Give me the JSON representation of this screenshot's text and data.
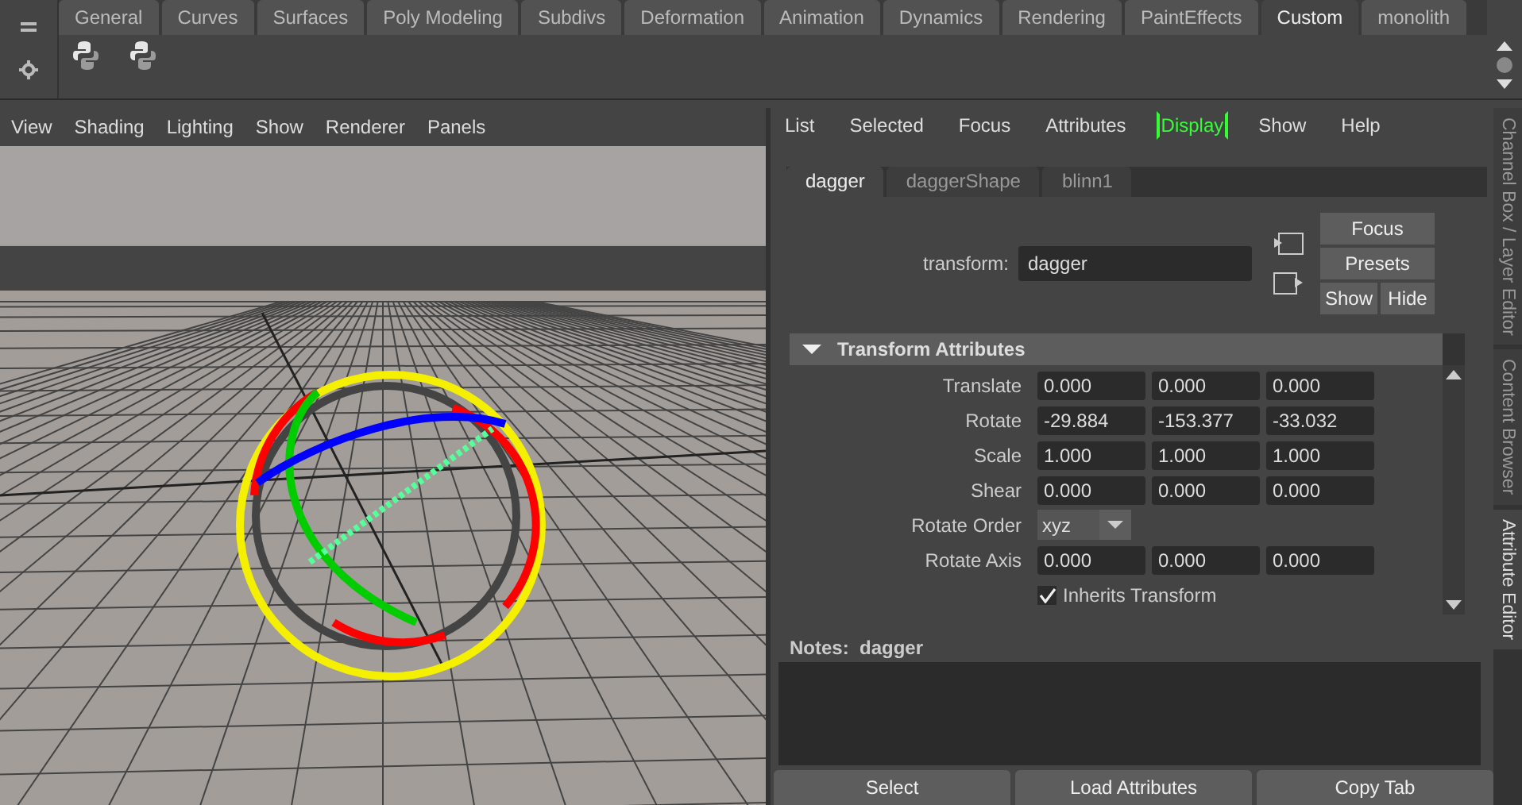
{
  "shelf": {
    "tabs": [
      {
        "label": "General",
        "selected": false
      },
      {
        "label": "Curves",
        "selected": false
      },
      {
        "label": "Surfaces",
        "selected": false
      },
      {
        "label": "Poly Modeling",
        "selected": false
      },
      {
        "label": "Subdivs",
        "selected": false
      },
      {
        "label": "Deformation",
        "selected": false
      },
      {
        "label": "Animation",
        "selected": false
      },
      {
        "label": "Dynamics",
        "selected": false
      },
      {
        "label": "Rendering",
        "selected": false
      },
      {
        "label": "PaintEffects",
        "selected": false
      },
      {
        "label": "Custom",
        "selected": true
      },
      {
        "label": "monolith",
        "selected": false
      }
    ]
  },
  "viewport": {
    "menu": [
      "View",
      "Shading",
      "Lighting",
      "Show",
      "Renderer",
      "Panels"
    ]
  },
  "attribute_editor": {
    "menu": [
      {
        "label": "List",
        "highlighted": false
      },
      {
        "label": "Selected",
        "highlighted": false
      },
      {
        "label": "Focus",
        "highlighted": false
      },
      {
        "label": "Attributes",
        "highlighted": false
      },
      {
        "label": "Display",
        "highlighted": true
      },
      {
        "label": "Show",
        "highlighted": false
      },
      {
        "label": "Help",
        "highlighted": false
      }
    ],
    "node_tabs": [
      {
        "label": "dagger",
        "selected": true
      },
      {
        "label": "daggerShape",
        "selected": false
      },
      {
        "label": "blinn1",
        "selected": false
      }
    ],
    "node_label": "transform:",
    "node_name": "dagger",
    "buttons": [
      "Focus",
      "Presets",
      "Show",
      "Hide"
    ],
    "section": {
      "title": "Transform Attributes",
      "expanded": true
    },
    "attributes": [
      {
        "kind": "vector",
        "label": "Translate",
        "values": [
          "0.000",
          "0.000",
          "0.000"
        ]
      },
      {
        "kind": "vector",
        "label": "Rotate",
        "values": [
          "-29.884",
          "-153.377",
          "-33.032"
        ]
      },
      {
        "kind": "vector",
        "label": "Scale",
        "values": [
          "1.000",
          "1.000",
          "1.000"
        ]
      },
      {
        "kind": "vector",
        "label": "Shear",
        "values": [
          "0.000",
          "0.000",
          "0.000"
        ]
      },
      {
        "kind": "dropdown",
        "label": "Rotate Order",
        "value": "xyz"
      },
      {
        "kind": "vector",
        "label": "Rotate Axis",
        "values": [
          "0.000",
          "0.000",
          "0.000"
        ]
      },
      {
        "kind": "checkbox",
        "label": "Inherits Transform",
        "checked": true
      }
    ],
    "notes_label": "Notes:  dagger",
    "bottom_buttons": [
      "Select",
      "Load Attributes",
      "Copy Tab"
    ]
  },
  "side_tabs": [
    {
      "label": "Channel Box / Layer Editor",
      "selected": false
    },
    {
      "label": "Content Browser",
      "selected": false
    },
    {
      "label": "Attribute Editor",
      "selected": true
    }
  ]
}
